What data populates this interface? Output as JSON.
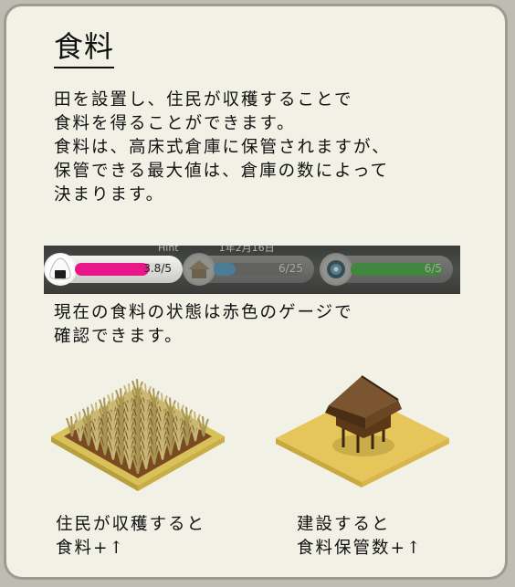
{
  "title": "食料",
  "description": [
    "田を設置し、住民が収穫することで",
    "食料を得ることができます。",
    "食料は、高床式倉庫に保管されますが、",
    "保管できる最大値は、倉庫の数によって",
    "決まります。"
  ],
  "hud": {
    "overlay_left": "Hint",
    "overlay_date": "1年2月16日",
    "gauges": [
      {
        "name": "food",
        "icon": "onigiri-icon",
        "value_label": "3.8/5",
        "fraction": 0.76,
        "color": "#e8188a",
        "dimmed": false
      },
      {
        "name": "housing",
        "icon": "house-icon",
        "value_label": "6/25",
        "fraction": 0.24,
        "color": "#4b8fb0",
        "dimmed": true
      },
      {
        "name": "magatama",
        "icon": "magatama-icon",
        "value_label": "6/5",
        "fraction": 1.0,
        "color": "#3f9b3b",
        "dimmed": true
      }
    ]
  },
  "subtext": [
    "現在の食料の状態は赤色のゲージで",
    "確認できます。"
  ],
  "items": [
    {
      "name": "rice-field",
      "icon": "rice-field-icon",
      "caption": [
        "住民が収穫すると",
        "食料+↑"
      ]
    },
    {
      "name": "storehouse",
      "icon": "raised-storehouse-icon",
      "caption": [
        "建設すると",
        "食料保管数+↑"
      ]
    }
  ]
}
